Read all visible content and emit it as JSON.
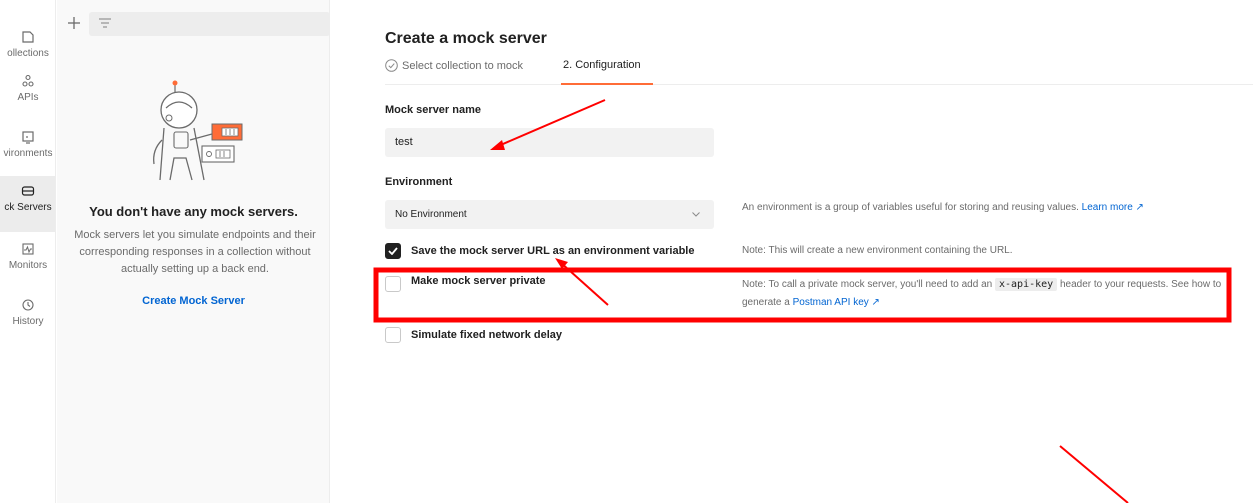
{
  "nav": {
    "items": [
      {
        "label": "ollections",
        "icon": "collections-icon"
      },
      {
        "label": "APIs",
        "icon": "apis-icon"
      },
      {
        "label": "vironments",
        "icon": "environments-icon"
      },
      {
        "label": "ck Servers",
        "icon": "mock-servers-icon"
      },
      {
        "label": "Monitors",
        "icon": "monitors-icon"
      },
      {
        "label": "History",
        "icon": "history-icon"
      }
    ]
  },
  "sidebar": {
    "empty_title": "You don't have any mock servers.",
    "empty_description": "Mock servers let you simulate endpoints and their corresponding responses in a collection without actually setting up a back end.",
    "create_link": "Create Mock Server"
  },
  "main": {
    "title": "Create a mock server",
    "steps": [
      {
        "label": "Select collection to mock",
        "state": "done"
      },
      {
        "label": "2. Configuration",
        "state": "active"
      }
    ],
    "name_label": "Mock server name",
    "name_value": "test",
    "environment_label": "Environment",
    "environment_value": "No Environment",
    "environment_note": "An environment is a group of variables useful for storing and reusing values.",
    "environment_note_link": "Learn more ↗",
    "save_url_label": "Save the mock server URL as an environment variable",
    "save_url_checked": true,
    "save_url_note": "Note: This will create a new environment containing the URL.",
    "private_label": "Make mock server private",
    "private_checked": false,
    "private_note_prefix": "Note: To call a private mock server, you'll need to add an",
    "private_note_code": "x-api-key",
    "private_note_mid": "header to your requests. See how to generate a",
    "private_note_link": "Postman API key ↗",
    "delay_label": "Simulate fixed network delay",
    "delay_checked": false
  },
  "colors": {
    "accent": "#ff6c37",
    "link": "#0265d2",
    "annotation": "#ff0000"
  }
}
